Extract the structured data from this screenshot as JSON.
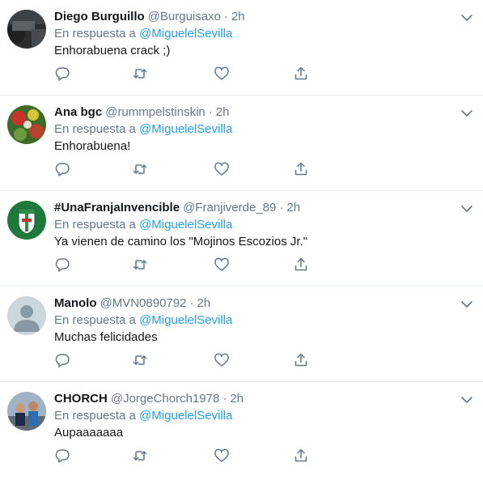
{
  "tweets": [
    {
      "name": "Diego Burguillo",
      "handle": "@Burguisaxo",
      "time": "2h",
      "reply_prefix": "En respuesta a",
      "reply_to": "@MiguelelSevilla",
      "text": "Enhorabuena crack ;)"
    },
    {
      "name": "Ana bgc",
      "handle": "@rummpelstinskin",
      "time": "2h",
      "reply_prefix": "En respuesta a",
      "reply_to": "@MiguelelSevilla",
      "text": "Enhorabuena!"
    },
    {
      "name": "#UnaFranjaInvencible",
      "handle": "@Franjiverde_89",
      "time": "2h",
      "reply_prefix": "En respuesta a",
      "reply_to": "@MiguelelSevilla",
      "text": "Ya vienen de camino los \"Mojinos Escozios Jr.\""
    },
    {
      "name": "Manolo",
      "handle": "@MVN0890792",
      "time": "2h",
      "reply_prefix": "En respuesta a",
      "reply_to": "@MiguelelSevilla",
      "text": "Muchas felicidades"
    },
    {
      "name": "CHORCH",
      "handle": "@JorgeChorch1978",
      "time": "2h",
      "reply_prefix": "En respuesta a",
      "reply_to": "@MiguelelSevilla",
      "text": "Aupaaaaaaa"
    }
  ],
  "separator": "·",
  "colors": {
    "link": "#1da1f2",
    "secondary": "#657786",
    "primary_text": "#14171a",
    "divider": "#e6ecf0"
  },
  "icons": [
    "reply-icon",
    "retweet-icon",
    "like-icon",
    "share-icon",
    "chevron-down-icon"
  ]
}
